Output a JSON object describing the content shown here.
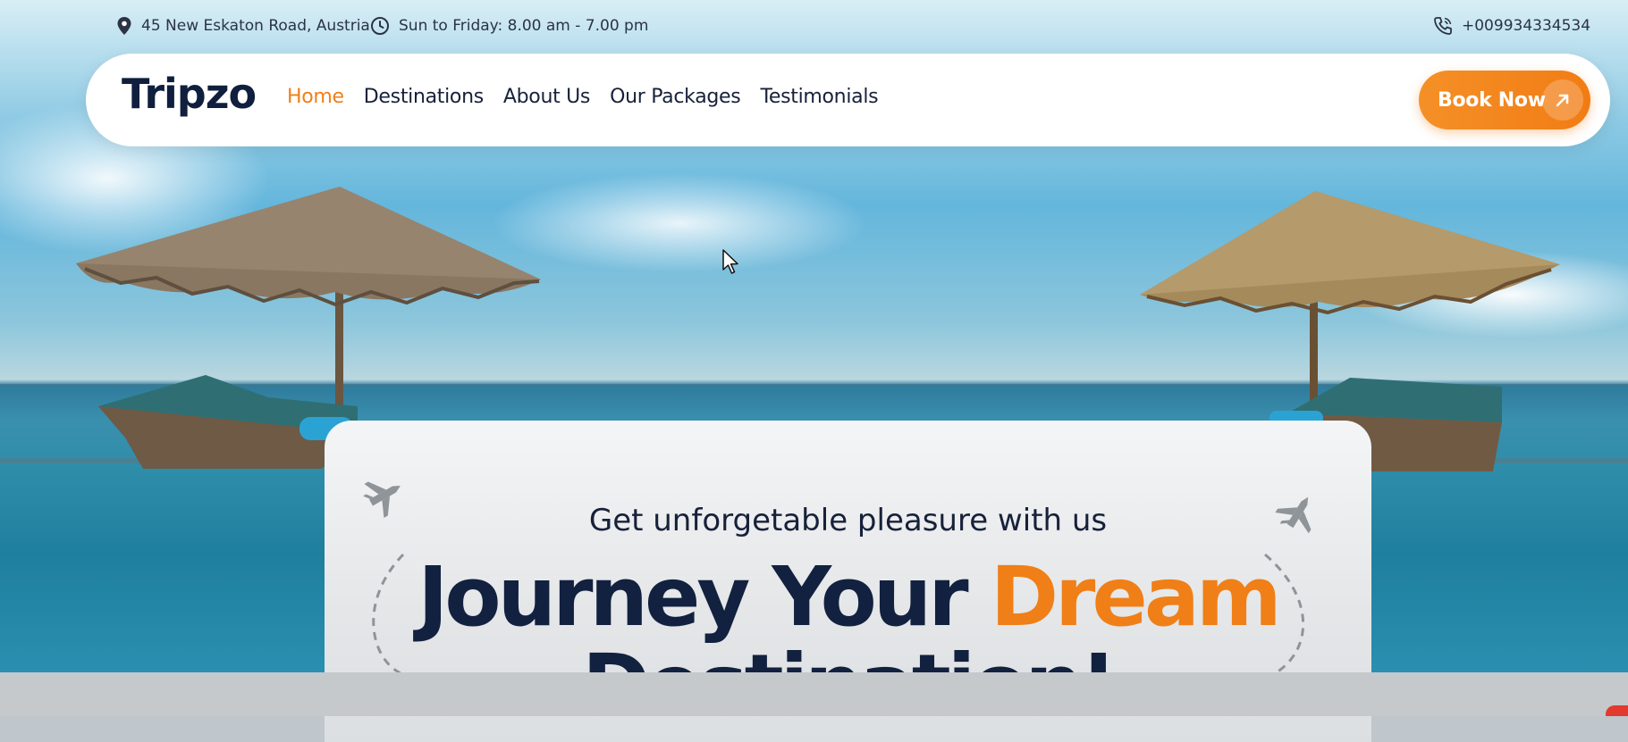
{
  "topbar": {
    "address": "45 New Eskaton Road, Austria",
    "hours": "Sun to Friday: 8.00 am - 7.00 pm",
    "phone": "+009934334534",
    "icons": [
      "location-pin-icon",
      "clock-icon",
      "phone-icon"
    ]
  },
  "nav": {
    "logo": "Tripzo",
    "items": [
      {
        "label": "Home",
        "active": true
      },
      {
        "label": "Destinations",
        "active": false
      },
      {
        "label": "About Us",
        "active": false
      },
      {
        "label": "Our Packages",
        "active": false
      },
      {
        "label": "Testimonials",
        "active": false
      }
    ],
    "cta": {
      "label": "Book Now",
      "icon": "arrow-up-right-icon"
    }
  },
  "hero": {
    "subtitle": "Get unforgetable pleasure with us",
    "title_part1": "Journey Your ",
    "title_accent": "Dream",
    "title_line2": "Destination!"
  },
  "colors": {
    "accent": "#f07f17",
    "navy": "#12213f",
    "nav_bg": "#ffffff"
  }
}
